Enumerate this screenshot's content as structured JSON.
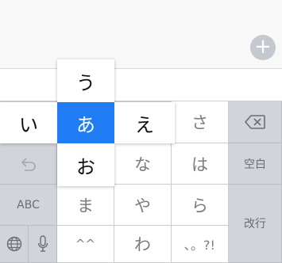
{
  "top": {
    "plus_label": "+"
  },
  "popup": {
    "up": "う",
    "left": "い",
    "center": "あ",
    "right": "え",
    "down": "お"
  },
  "keys": {
    "sa": "さ",
    "na": "な",
    "ha": "は",
    "abc": "ABC",
    "ma": "ま",
    "ya": "や",
    "ra": "ら",
    "space": "空白",
    "enter": "改行",
    "emoticon": "^^",
    "wa": "わ",
    "punct": "､。?!"
  },
  "icons": {
    "delete": "delete-icon",
    "undo": "undo-icon",
    "globe": "globe-icon",
    "mic": "microphone-icon"
  },
  "colors": {
    "accent": "#1f7cf5",
    "keyboard_bg": "#d1d4d9",
    "key_bg": "#ffffff"
  }
}
